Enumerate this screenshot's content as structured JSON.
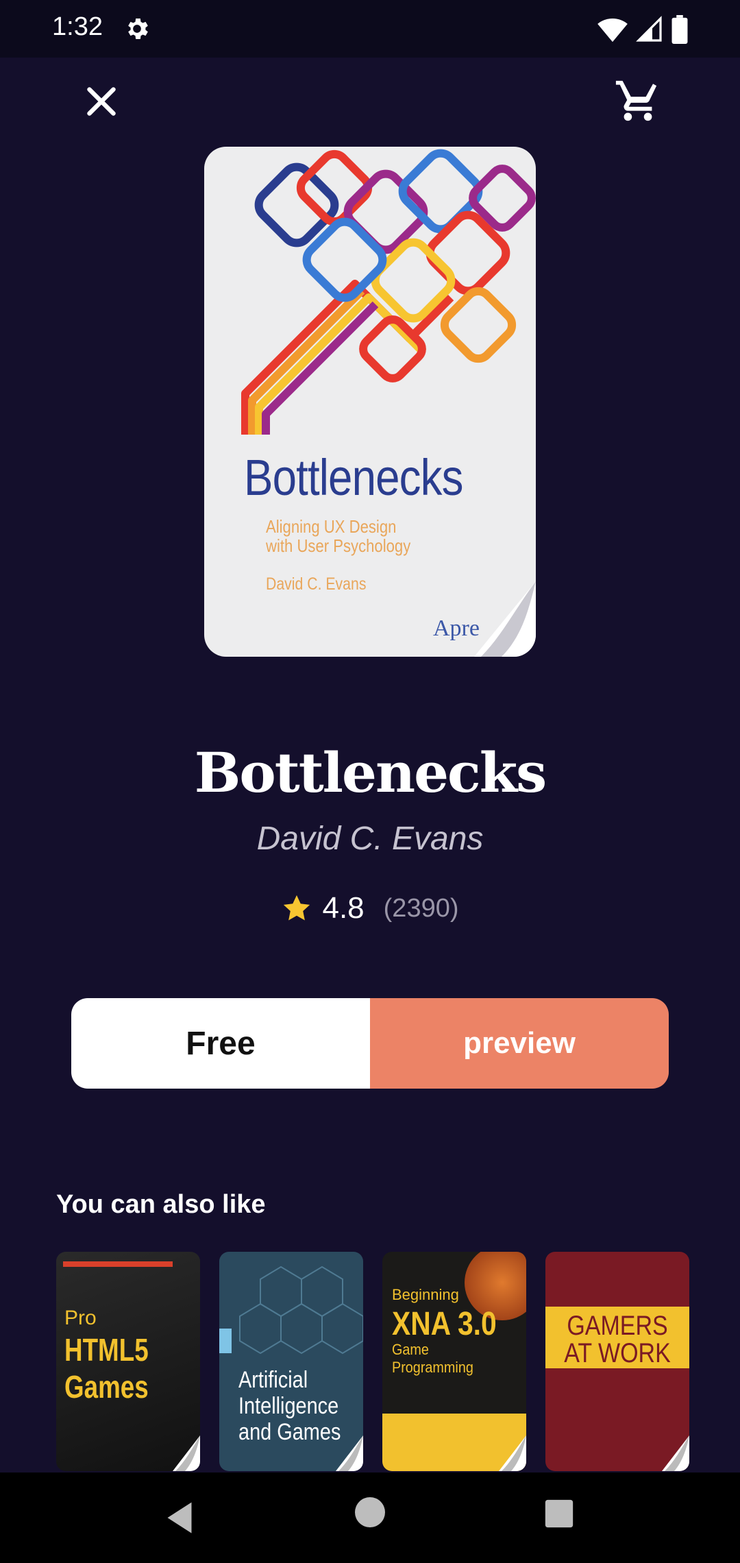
{
  "status_bar": {
    "time": "1:32"
  },
  "book": {
    "title": "Bottlenecks",
    "author": "David C. Evans",
    "rating": "4.8",
    "rating_count": "(2390)",
    "cover": {
      "title": "Bottlenecks",
      "subtitle": "Aligning UX Design with User Psychology",
      "author": "David C. Evans",
      "publisher": "Apre"
    }
  },
  "actions": {
    "free_label": "Free",
    "preview_label": "preview"
  },
  "suggestions": {
    "title": "You can also like",
    "items": [
      {
        "line1": "Pro",
        "line2": "HTML5",
        "line3": "Games"
      },
      {
        "line1": "Artificial",
        "line2": "Intelligence",
        "line3": "and Games"
      },
      {
        "line1": "Beginning",
        "line2": "XNA 3.0",
        "line3": "Game Programming"
      },
      {
        "line1": "GAMERS",
        "line2": "AT WORK",
        "line3": ""
      }
    ]
  },
  "colors": {
    "background": "#140f2c",
    "preview_button": "#ec8366",
    "star": "#f7c531"
  }
}
